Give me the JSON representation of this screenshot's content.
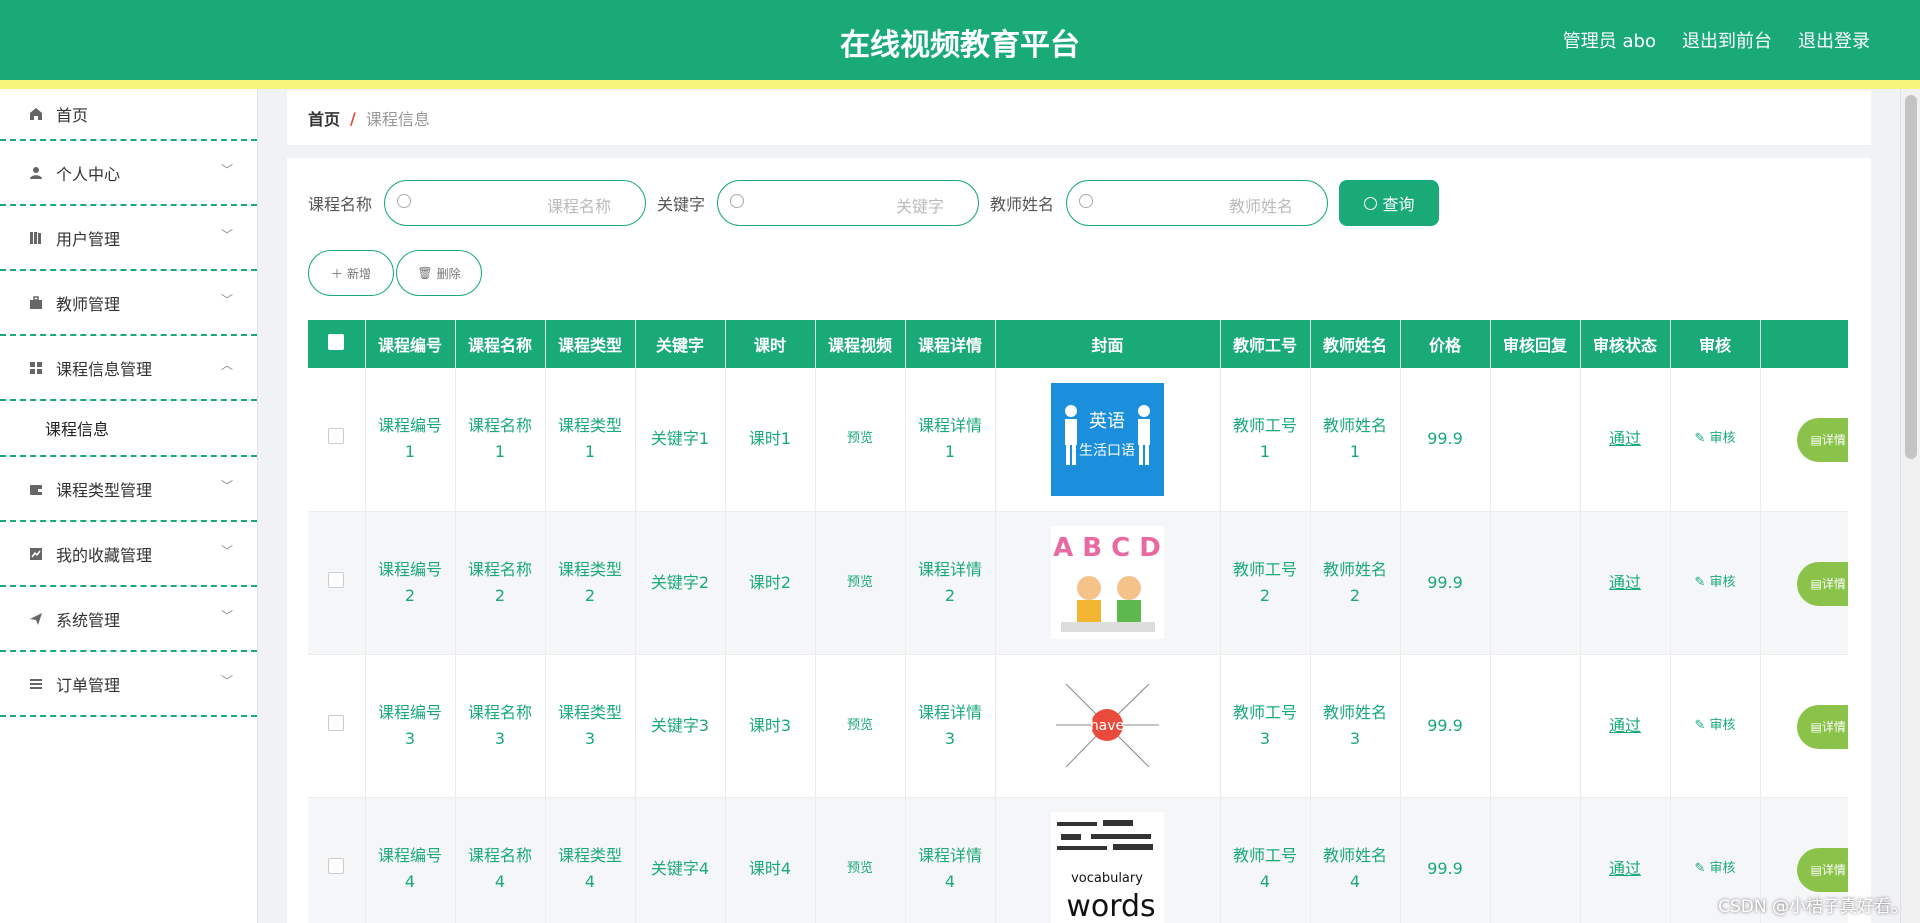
{
  "header": {
    "title": "在线视频教育平台",
    "admin": "管理员 abo",
    "back_front": "退出到前台",
    "logout": "退出登录"
  },
  "sidebar": {
    "items": [
      {
        "label": "首页",
        "icon": "home-icon"
      },
      {
        "label": "个人中心",
        "icon": "user-icon"
      },
      {
        "label": "用户管理",
        "icon": "book-icon"
      },
      {
        "label": "教师管理",
        "icon": "briefcase-icon"
      },
      {
        "label": "课程信息管理",
        "icon": "grid-icon"
      },
      {
        "label": "课程类型管理",
        "icon": "wallet-icon"
      },
      {
        "label": "我的收藏管理",
        "icon": "chart-icon"
      },
      {
        "label": "系统管理",
        "icon": "send-icon"
      },
      {
        "label": "订单管理",
        "icon": "list-icon"
      }
    ],
    "sub_item": "课程信息"
  },
  "breadcrumb": {
    "home": "首页",
    "sep": "/",
    "current": "课程信息"
  },
  "search": {
    "name_label": "课程名称",
    "name_placeholder": "课程名称",
    "kw_label": "关键字",
    "kw_placeholder": "关键字",
    "teacher_label": "教师姓名",
    "teacher_placeholder": "教师姓名",
    "query": "查询"
  },
  "actions": {
    "add": "新增",
    "delete": "删除"
  },
  "table": {
    "headers": [
      "课程编号",
      "课程名称",
      "课程类型",
      "关键字",
      "课时",
      "课程视频",
      "课程详情",
      "封面",
      "教师工号",
      "教师姓名",
      "价格",
      "审核回复",
      "审核状态",
      "审核"
    ],
    "preview": "预览",
    "audit": "审核",
    "detail": "详情",
    "rows": [
      {
        "code": "课程编号",
        "name": "课程名称",
        "type": "课程类型",
        "idx": "1",
        "kw": "关键字1",
        "hours": "课时1",
        "detail": "课程详情",
        "tno": "教师工号",
        "tname": "教师姓名",
        "price": "99.9",
        "status": "通过"
      },
      {
        "code": "课程编号",
        "name": "课程名称",
        "type": "课程类型",
        "idx": "2",
        "kw": "关键字2",
        "hours": "课时2",
        "detail": "课程详情",
        "tno": "教师工号",
        "tname": "教师姓名",
        "price": "99.9",
        "status": "通过"
      },
      {
        "code": "课程编号",
        "name": "课程名称",
        "type": "课程类型",
        "idx": "3",
        "kw": "关键字3",
        "hours": "课时3",
        "detail": "课程详情",
        "tno": "教师工号",
        "tname": "教师姓名",
        "price": "99.9",
        "status": "通过"
      },
      {
        "code": "课程编号",
        "name": "课程名称",
        "type": "课程类型",
        "idx": "4",
        "kw": "关键字4",
        "hours": "课时4",
        "detail": "课程详情",
        "tno": "教师工号",
        "tname": "教师姓名",
        "price": "99.9",
        "status": "通过"
      }
    ]
  },
  "cover_texts": {
    "c1": "英语",
    "c1b": "生活口语",
    "c2": "A B C D",
    "c3": "have",
    "c4": "words",
    "c4b": "vocabulary"
  },
  "watermark": "CSDN @小桔子真好看。",
  "colors": {
    "primary": "#1aaa78",
    "accent_yellow": "#f7f57c",
    "detail_green": "#8bc34a"
  }
}
